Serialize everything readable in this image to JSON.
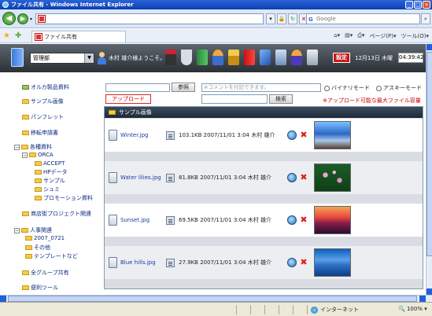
{
  "window": {
    "title": "ファイル共有 - Windows Internet Explorer"
  },
  "browser": {
    "search_placeholder": "Google",
    "tab_title": "ファイル共有",
    "commands": {
      "page": "ページ(P)",
      "tools": "ツール(O)"
    }
  },
  "app": {
    "department": "管理部",
    "welcome": "木村 雄介様ようこそ。",
    "settings_label": "設定",
    "date": "12月13日 木曜",
    "time": "04:39:42"
  },
  "sidebar": {
    "items": [
      {
        "label": "オルカ製品資料"
      },
      {
        "label": "サンプル画像"
      },
      {
        "label": "パンフレット"
      },
      {
        "label": "移転申請書"
      },
      {
        "label": "各種資料"
      },
      {
        "label": "ORCA"
      },
      {
        "label": "ACCEPT"
      },
      {
        "label": "HPデータ"
      },
      {
        "label": "サンプル"
      },
      {
        "label": "シュミ"
      },
      {
        "label": "プロモーション資料"
      },
      {
        "label": "商店街プロジェクト関連"
      },
      {
        "label": "人事関連"
      },
      {
        "label": "2007_0721"
      },
      {
        "label": "その他"
      },
      {
        "label": "テンプレートなど"
      },
      {
        "label": "全グループ共有"
      },
      {
        "label": "便利ツール"
      }
    ]
  },
  "upload": {
    "browse_label": "参照",
    "comment_placeholder": "※コメントを付記できます。",
    "binary_mode": "バイナリモード",
    "ascii_mode": "アスキーモード",
    "upload_label": "アップロード",
    "search_label": "検索",
    "notice": "※アップロード可能な最大ファイル容量"
  },
  "gallery": {
    "folder_title": "サンプル画像",
    "files": [
      {
        "name": "Winter.jpg",
        "size": "103.1KB",
        "date": "2007/11/01",
        "time": "3:04",
        "owner": "木村 雄介"
      },
      {
        "name": "Water lilies.jpg",
        "size": "81.8KB",
        "date": "2007/11/01",
        "time": "3:04",
        "owner": "木村 雄介"
      },
      {
        "name": "Sunset.jpg",
        "size": "69.5KB",
        "date": "2007/11/01",
        "time": "3:04",
        "owner": "木村 雄介"
      },
      {
        "name": "Blue hills.jpg",
        "size": "27.9KB",
        "date": "2007/11/01",
        "time": "3:04",
        "owner": "木村 雄介"
      }
    ]
  },
  "status": {
    "zone": "インターネット",
    "zoom": "100%"
  },
  "colors": {
    "titlebar": "#0b3fb2",
    "toolbar": "#2b3036",
    "link": "#1b3ba8",
    "alert": "#cc0000"
  }
}
